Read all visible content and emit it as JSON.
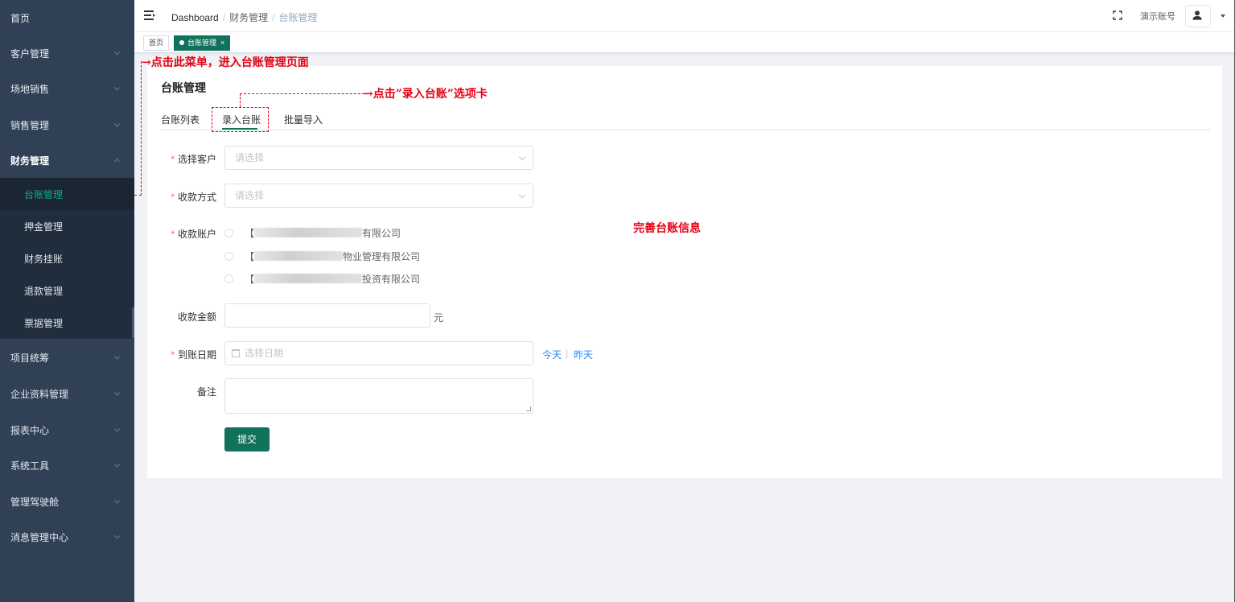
{
  "sidebar": {
    "items": [
      {
        "label": "首页",
        "has_chevron": false
      },
      {
        "label": "客户管理",
        "has_chevron": true
      },
      {
        "label": "场地销售",
        "has_chevron": true
      },
      {
        "label": "销售管理",
        "has_chevron": true
      },
      {
        "label": "财务管理",
        "has_chevron": true,
        "expanded": true
      },
      {
        "label": "项目统筹",
        "has_chevron": true
      },
      {
        "label": "企业资料管理",
        "has_chevron": true
      },
      {
        "label": "报表中心",
        "has_chevron": true
      },
      {
        "label": "系统工具",
        "has_chevron": true
      },
      {
        "label": "管理驾驶舱",
        "has_chevron": true
      },
      {
        "label": "消息管理中心",
        "has_chevron": true
      }
    ],
    "sub_items": [
      {
        "label": "台账管理",
        "active": true
      },
      {
        "label": "押金管理"
      },
      {
        "label": "财务挂账"
      },
      {
        "label": "退款管理"
      },
      {
        "label": "票据管理"
      }
    ]
  },
  "navbar": {
    "breadcrumb": [
      "Dashboard",
      "财务管理",
      "台账管理"
    ],
    "account_name": "演示账号",
    "icons": [
      "hamburger-icon",
      "fullscreen-icon",
      "user-icon",
      "caret-down-icon"
    ]
  },
  "tags": [
    {
      "label": "首页",
      "active": false
    },
    {
      "label": "台账管理",
      "active": true,
      "close": "×"
    }
  ],
  "page": {
    "title": "台账管理",
    "tabs": [
      "台账列表",
      "录入台账",
      "批量导入"
    ],
    "active_tab": "录入台账"
  },
  "form": {
    "customer": {
      "label": "选择客户",
      "required": true,
      "placeholder": "请选择"
    },
    "payment_method": {
      "label": "收款方式",
      "required": true,
      "placeholder": "请选择"
    },
    "account": {
      "label": "收款账户",
      "required": true,
      "options": [
        {
          "prefix": "【",
          "suffix": "有限公司"
        },
        {
          "prefix": "【",
          "suffix": "物业管理有限公司"
        },
        {
          "prefix": "【",
          "suffix": "投资有限公司"
        }
      ]
    },
    "amount": {
      "label": "收款金额",
      "required": false,
      "unit": "元"
    },
    "arrival_date": {
      "label": "到账日期",
      "required": true,
      "placeholder": "选择日期",
      "quick": [
        "今天",
        "昨天"
      ],
      "quick_sep": "|"
    },
    "remark": {
      "label": "备注",
      "required": false
    },
    "submit_label": "提交",
    "required_mark": "*"
  },
  "annotations": {
    "menu_hint": "→点击此菜单，进入台账管理页面",
    "tab_hint": "→点击”录入台账”选项卡",
    "form_hint": "完善台账信息"
  },
  "colors": {
    "sidebar_bg": "#304156",
    "submenu_bg": "#1f2d3d",
    "primary": "#11725b",
    "active_menu_text": "#11a983",
    "annotation_red": "#e60012",
    "link_blue": "#1890ff"
  }
}
